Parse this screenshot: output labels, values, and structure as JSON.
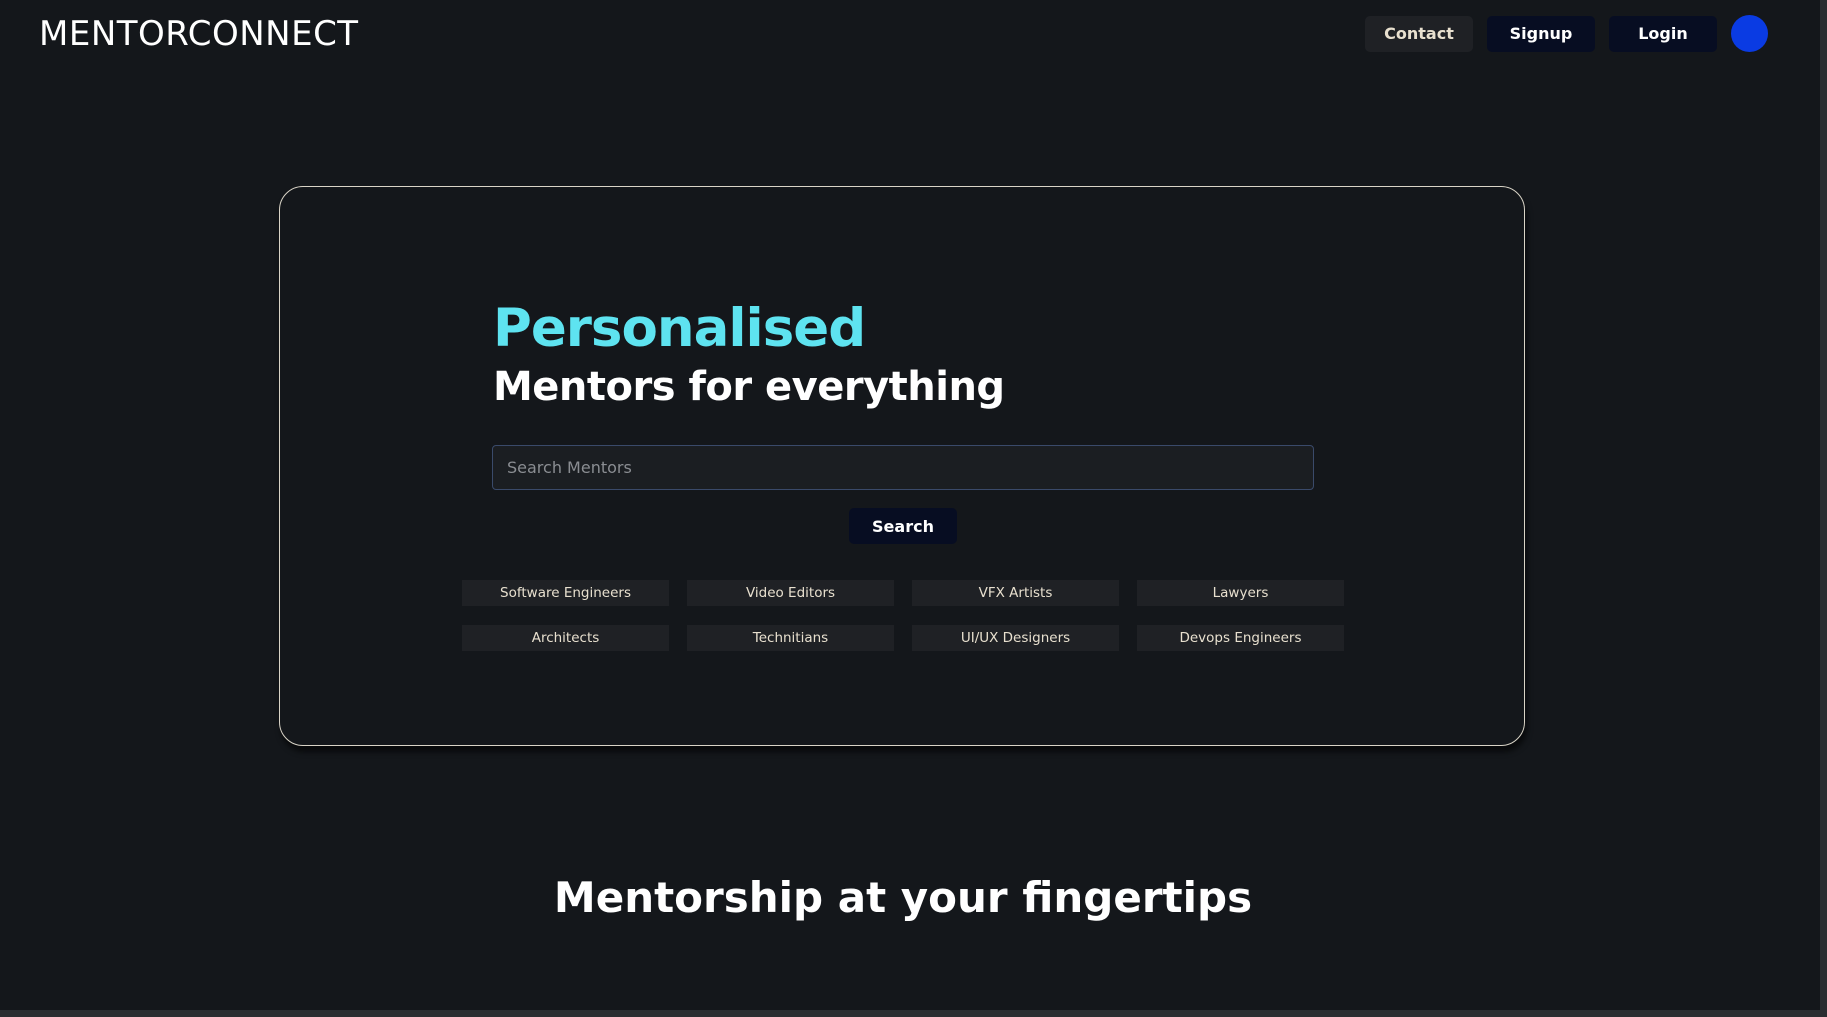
{
  "header": {
    "logo": "MENTORCONNECT",
    "nav": {
      "contact_label": "Contact",
      "signup_label": "Signup",
      "login_label": "Login"
    }
  },
  "hero": {
    "title": "Personalised",
    "subtitle": "Mentors for everything",
    "search": {
      "placeholder": "Search Mentors",
      "value": "",
      "button_label": "Search"
    },
    "categories": [
      "Software Engineers",
      "Video Editors",
      "VFX Artists",
      "Lawyers",
      "Architects",
      "Technitians",
      "UI/UX Designers",
      "Devops Engineers"
    ]
  },
  "section": {
    "heading": "Mentorship at your fingertips"
  },
  "colors": {
    "background": "#14171b",
    "accent_cyan": "#5ee3f0",
    "button_dark": "#070d22",
    "chip_bg": "#1f2125",
    "avatar_blue": "#0a3be3"
  }
}
